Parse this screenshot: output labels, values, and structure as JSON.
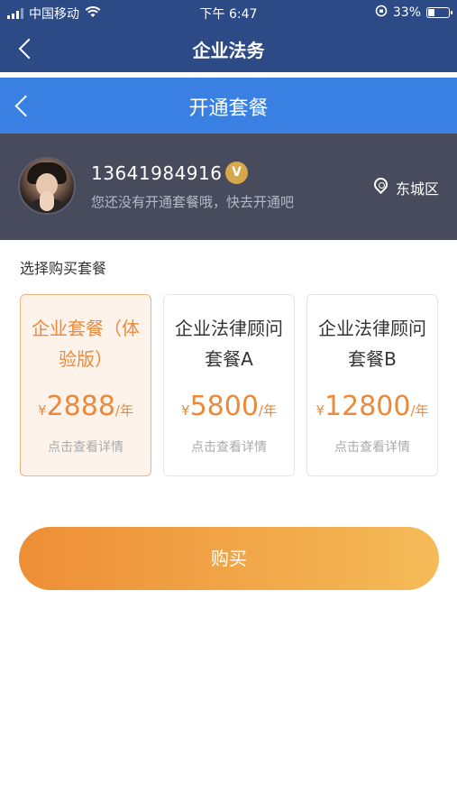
{
  "status_bar": {
    "carrier": "中国移动",
    "time": "下午 6:47",
    "battery": "33%",
    "battery_level": 0.33
  },
  "nav_outer": {
    "title": "企业法务"
  },
  "nav_inner": {
    "title": "开通套餐"
  },
  "profile": {
    "phone": "13641984916",
    "vip_badge": "V",
    "hint": "您还没有开通套餐哦，快去开通吧",
    "location": "东城区"
  },
  "plans_section": {
    "label": "选择购买套餐",
    "plans": [
      {
        "name": "企业套餐（体验版）",
        "currency": "¥",
        "amount": "2888",
        "unit": "/年",
        "detail": "点击查看详情",
        "selected": true
      },
      {
        "name": "企业法律顾问套餐A",
        "currency": "¥",
        "amount": "5800",
        "unit": "/年",
        "detail": "点击查看详情",
        "selected": false
      },
      {
        "name": "企业法律顾问套餐B",
        "currency": "¥",
        "amount": "12800",
        "unit": "/年",
        "detail": "点击查看详情",
        "selected": false
      }
    ]
  },
  "buy_button": {
    "label": "购买"
  },
  "colors": {
    "outer_nav": "#2b4a86",
    "inner_nav": "#3a80e3",
    "profile_bg": "#474b5c",
    "accent": "#ea8a3a"
  }
}
